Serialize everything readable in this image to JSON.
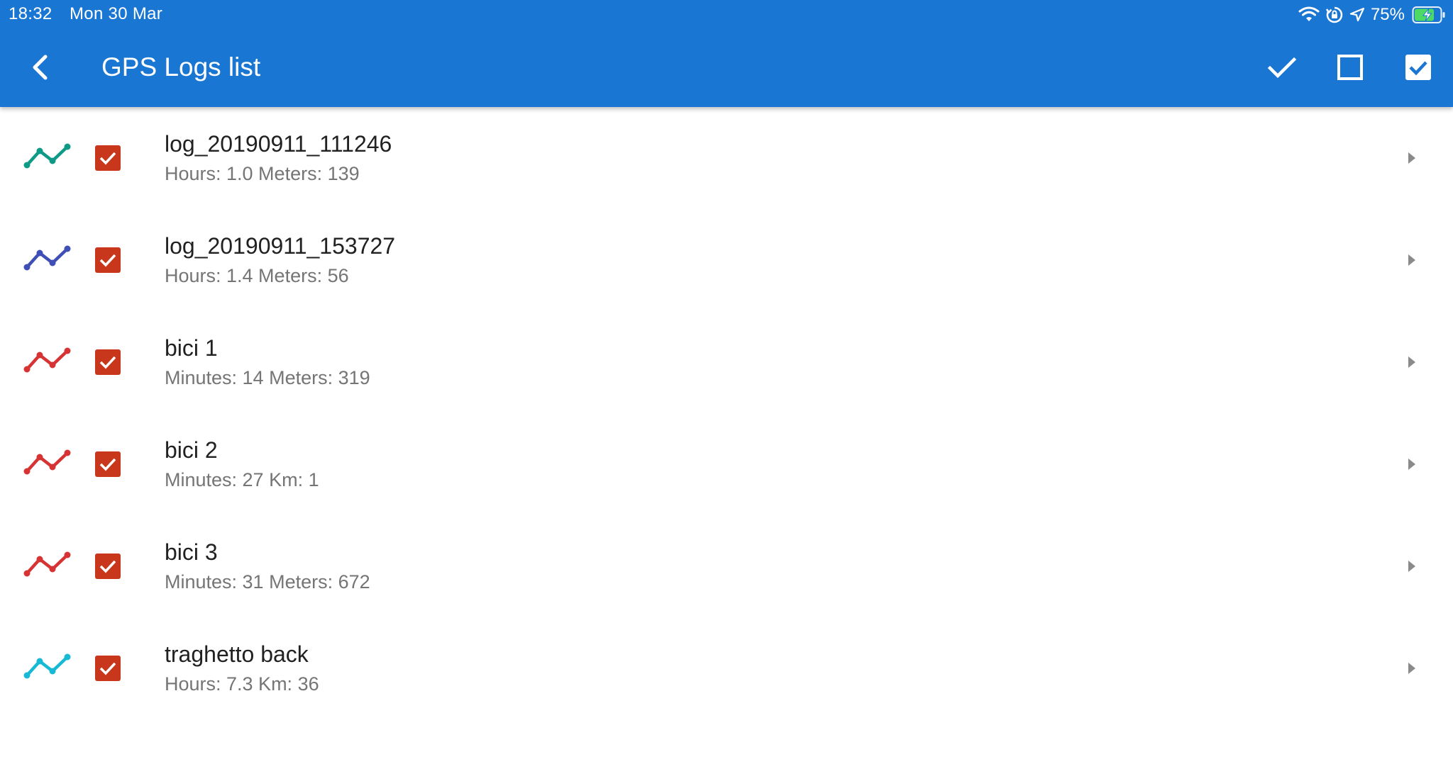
{
  "status_bar": {
    "time": "18:32",
    "date": "Mon 30 Mar",
    "battery": "75%",
    "icons": [
      "wifi-icon",
      "orientation-lock-icon",
      "location-arrow-icon",
      "battery-charging-icon"
    ]
  },
  "toolbar": {
    "title": "GPS Logs list",
    "back_icon": "back-chevron-icon",
    "actions": [
      "checkmark-icon",
      "checkbox-outline-icon",
      "checkbox-checked-icon"
    ]
  },
  "colors": {
    "appbar": "#1976d2",
    "checkbox": "#c8371b",
    "teal": "#0f9a87",
    "indigo": "#3f4fb5",
    "red": "#d63434",
    "cyan": "#17b9d4"
  },
  "logs": [
    {
      "name": "log_20190911_111246",
      "summary": "Hours: 1.0 Meters: 139",
      "color": "#0f9a87",
      "checked": true
    },
    {
      "name": "log_20190911_153727",
      "summary": "Hours: 1.4 Meters: 56",
      "color": "#3f4fb5",
      "checked": true
    },
    {
      "name": "bici 1",
      "summary": "Minutes: 14 Meters: 319",
      "color": "#d63434",
      "checked": true
    },
    {
      "name": "bici 2",
      "summary": "Minutes: 27 Km: 1",
      "color": "#d63434",
      "checked": true
    },
    {
      "name": "bici 3",
      "summary": "Minutes: 31 Meters: 672",
      "color": "#d63434",
      "checked": true
    },
    {
      "name": "traghetto back",
      "summary": "Hours: 7.3 Km: 36",
      "color": "#17b9d4",
      "checked": true
    }
  ]
}
